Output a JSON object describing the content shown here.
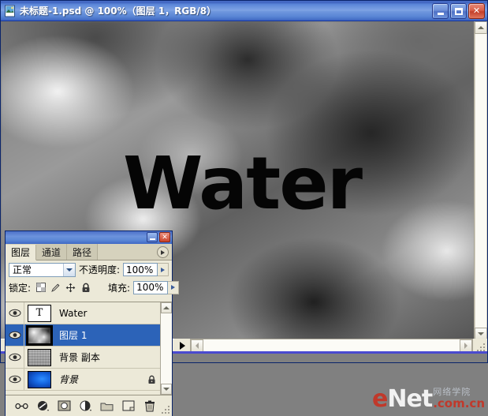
{
  "window": {
    "title": "未标题-1.psd @ 100%（图层 1，RGB/8）",
    "icon_name": "photoshop-document-icon",
    "buttons": {
      "minimize": "_",
      "maximize": "□",
      "close": "✕"
    }
  },
  "canvas": {
    "text_layer_content": "Water",
    "background_description": "clouds-render-grayscale"
  },
  "status_bar": {
    "text": "",
    "expander_name": "status-expander-triangle"
  },
  "panel": {
    "title_buttons": {
      "minimize": "_",
      "close": "✕"
    },
    "tabs": [
      {
        "label": "图层",
        "active": true
      },
      {
        "label": "通道",
        "active": false
      },
      {
        "label": "路径",
        "active": false
      }
    ],
    "menu_icon": "panel-menu-icon",
    "blend_mode": "正常",
    "opacity_label": "不透明度:",
    "opacity_value": "100%",
    "lock_label": "锁定:",
    "lock_icons": [
      "lock-transparency-icon",
      "lock-pixels-icon",
      "lock-position-icon",
      "lock-all-icon"
    ],
    "fill_label": "填充:",
    "fill_value": "100%",
    "layers": [
      {
        "name": "Water",
        "thumb": "text-T",
        "visible": true,
        "selected": false,
        "locked": false,
        "italic": false
      },
      {
        "name": "图层 1",
        "thumb": "clouds",
        "visible": true,
        "selected": true,
        "locked": false,
        "italic": false
      },
      {
        "name": "背景 副本",
        "thumb": "noise",
        "visible": true,
        "selected": false,
        "locked": false,
        "italic": false
      },
      {
        "name": "背景",
        "thumb": "blue-gradient",
        "visible": true,
        "selected": false,
        "locked": true,
        "italic": true
      }
    ],
    "footer_buttons": [
      "link-layers-icon",
      "layer-style-fx-icon",
      "add-layer-mask-icon",
      "new-adjustment-layer-icon",
      "new-group-icon",
      "new-layer-icon",
      "delete-layer-icon"
    ]
  },
  "watermark": {
    "e": "e",
    "net": "Net",
    "cn_text": "网络学院",
    "domain": ".com.cn"
  },
  "colors": {
    "titlebar_blue": "#4b70c8",
    "selection_blue": "#2c63b8",
    "panel_bg": "#ece9d8",
    "desktop_gray": "#808080",
    "accent_red": "#c0392b"
  }
}
